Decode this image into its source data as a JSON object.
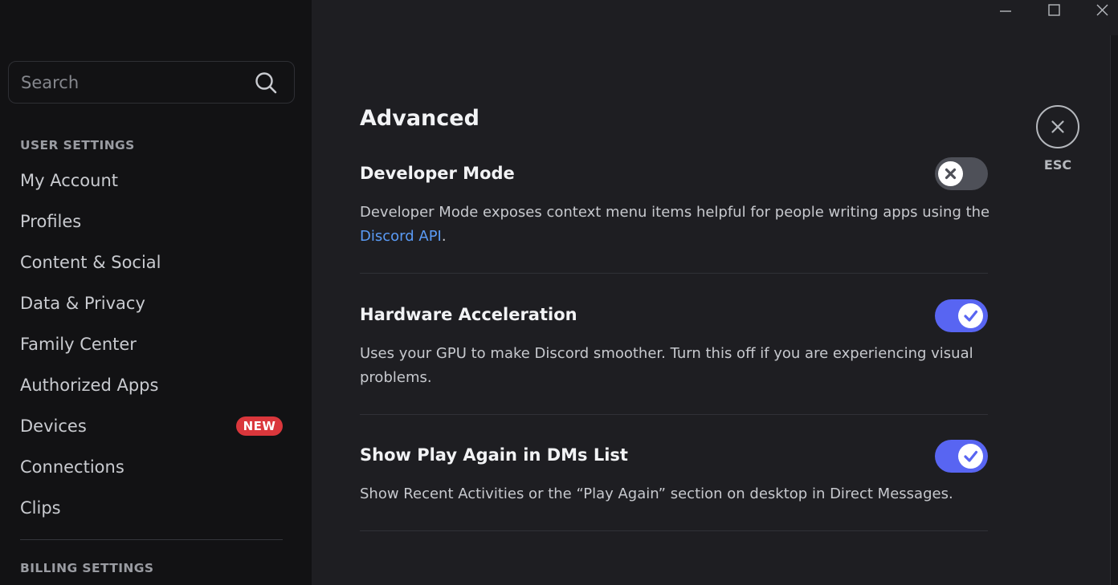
{
  "sidebar": {
    "search_placeholder": "Search",
    "user_settings_header": "USER SETTINGS",
    "items": [
      {
        "label": "My Account"
      },
      {
        "label": "Profiles"
      },
      {
        "label": "Content & Social"
      },
      {
        "label": "Data & Privacy"
      },
      {
        "label": "Family Center"
      },
      {
        "label": "Authorized Apps"
      },
      {
        "label": "Devices",
        "badge": "NEW"
      },
      {
        "label": "Connections"
      },
      {
        "label": "Clips"
      }
    ],
    "billing_settings_header": "BILLING SETTINGS"
  },
  "main": {
    "title": "Advanced",
    "settings": [
      {
        "title": "Developer Mode",
        "desc_before_link": "Developer Mode exposes context menu items helpful for people writing apps using the ",
        "link_text": "Discord API",
        "desc_after_link": ".",
        "enabled": false
      },
      {
        "title": "Hardware Acceleration",
        "description": "Uses your GPU to make Discord smoother. Turn this off if you are experiencing visual problems.",
        "enabled": true
      },
      {
        "title": "Show Play Again in DMs List",
        "description": "Show Recent Activities or the “Play Again” section on desktop in Direct Messages.",
        "enabled": true
      }
    ]
  },
  "esc": {
    "label": "ESC",
    "icon": "close-icon"
  },
  "window_controls": [
    "minimize-icon",
    "maximize-icon",
    "close-window-icon"
  ],
  "colors": {
    "accent": "#5865f2",
    "link": "#5a9bf6",
    "badge": "#da373c",
    "toggle_off": "#4e5058"
  }
}
